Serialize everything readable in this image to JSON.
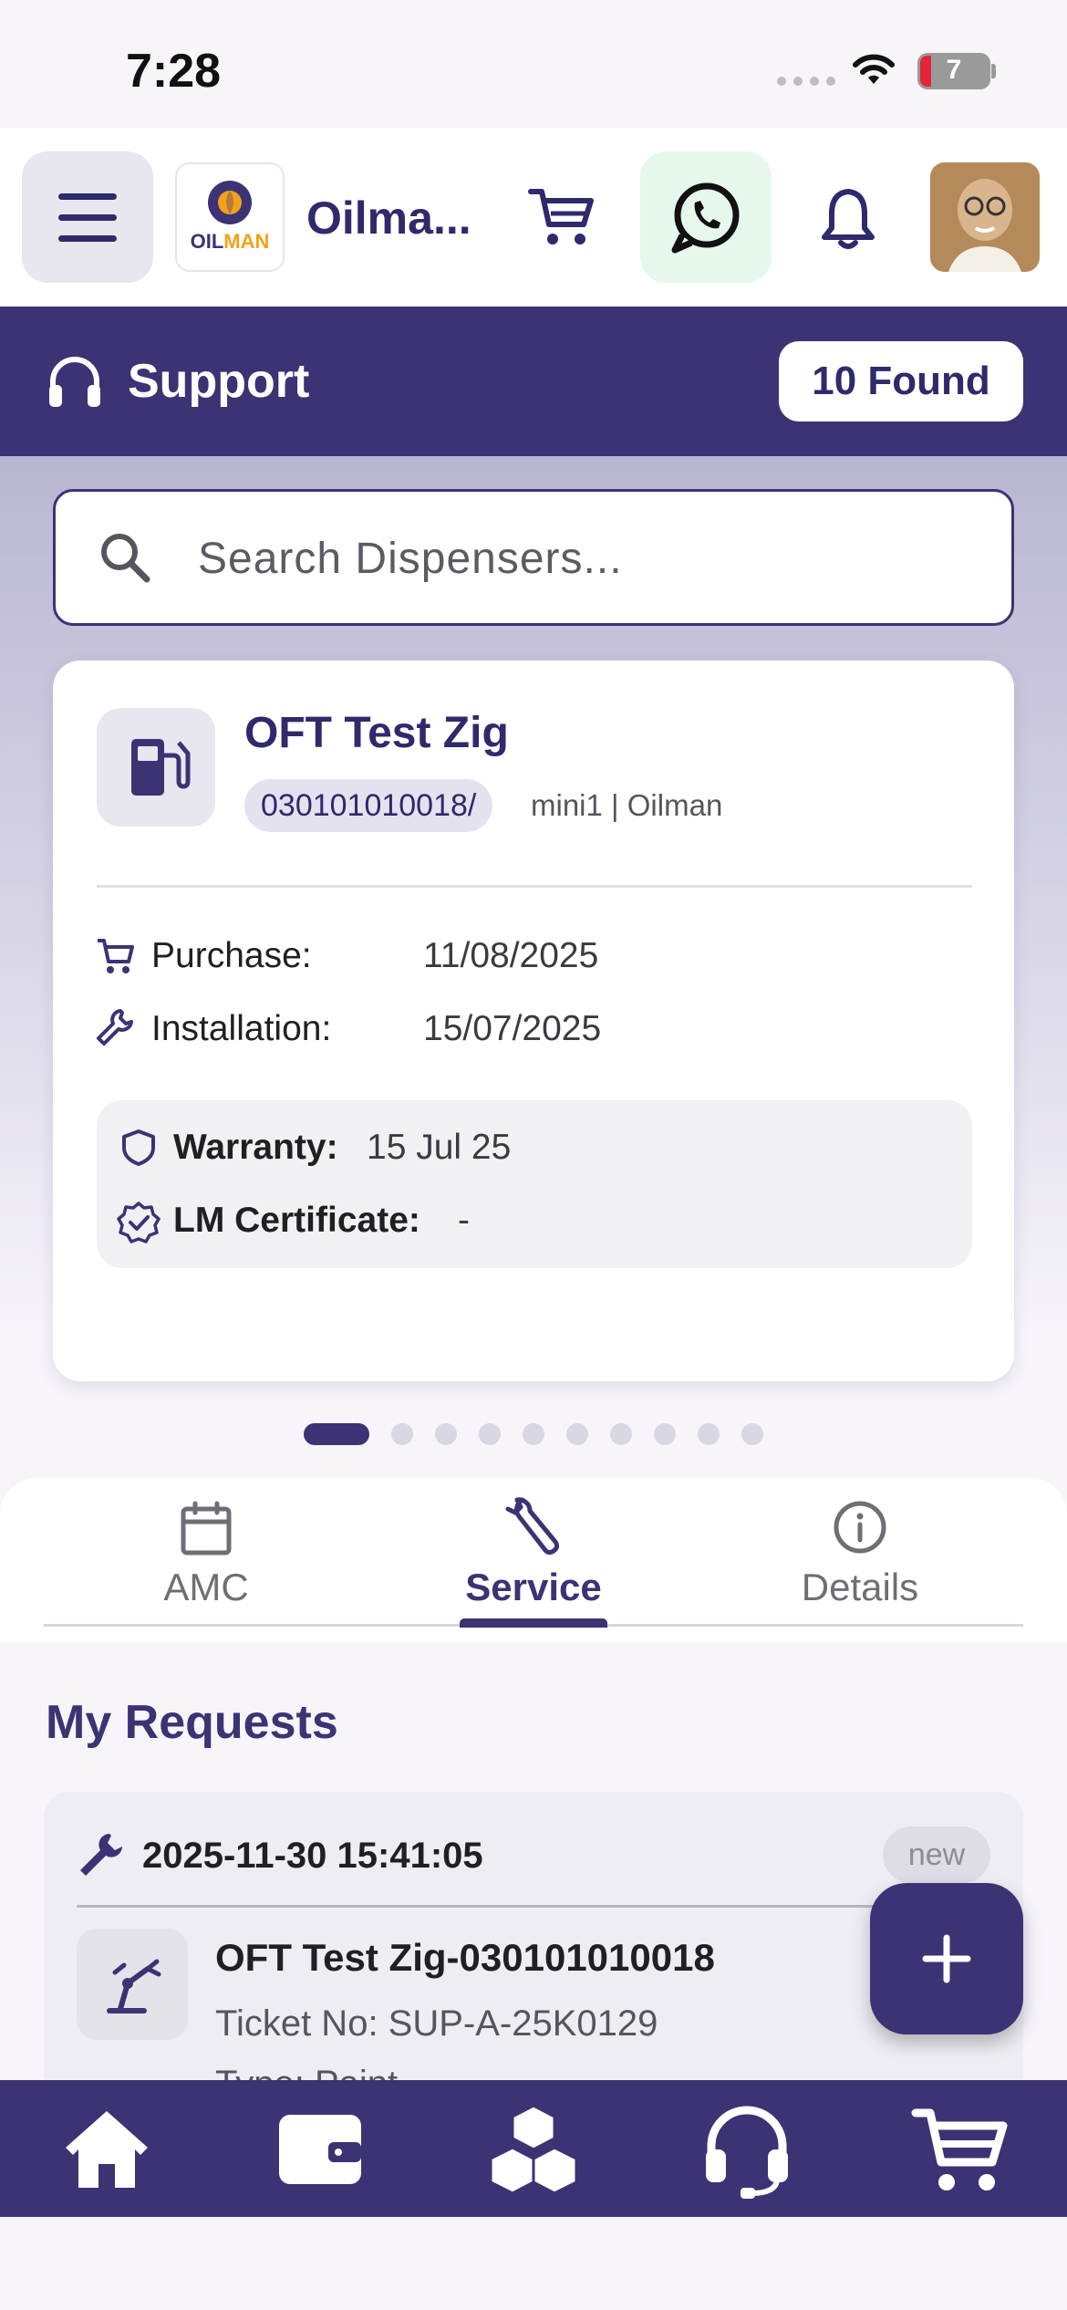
{
  "status_bar": {
    "time": "7:28",
    "battery": "7"
  },
  "header": {
    "brand": "Oilma...",
    "logo_text": "OILMAN"
  },
  "support": {
    "title": "Support",
    "found": "10 Found"
  },
  "search": {
    "placeholder": "Search Dispensers..."
  },
  "dispenser": {
    "name": "OFT Test Zig",
    "serial": "030101010018/",
    "model": "mini1 | Oilman",
    "purchase_label": "Purchase:",
    "purchase_date": "11/08/2025",
    "installation_label": "Installation:",
    "installation_date": "15/07/2025",
    "warranty_label": "Warranty:",
    "warranty_value": "15 Jul 25",
    "lm_label": "LM Certificate:",
    "lm_value": "-"
  },
  "pager": {
    "count": 10,
    "active": 0
  },
  "tabs": [
    {
      "label": "AMC",
      "icon": "calendar-icon"
    },
    {
      "label": "Service",
      "icon": "wrench-icon",
      "active": true
    },
    {
      "label": "Details",
      "icon": "info-icon"
    }
  ],
  "requests": {
    "title": "My Requests",
    "items": [
      {
        "datetime": "2025-11-30 15:41:05",
        "status": "new",
        "title": "OFT Test Zig-030101010018",
        "ticket": "Ticket No: SUP-A-25K0129",
        "type": "Type: Paint"
      }
    ]
  },
  "bottom_nav": [
    "home-icon",
    "wallet-icon",
    "boxes-icon",
    "headset-icon",
    "cart-icon"
  ],
  "colors": {
    "primary": "#3c3374",
    "whatsapp_bg": "#e6f7ec",
    "logo_orange": "#f3a11b"
  }
}
